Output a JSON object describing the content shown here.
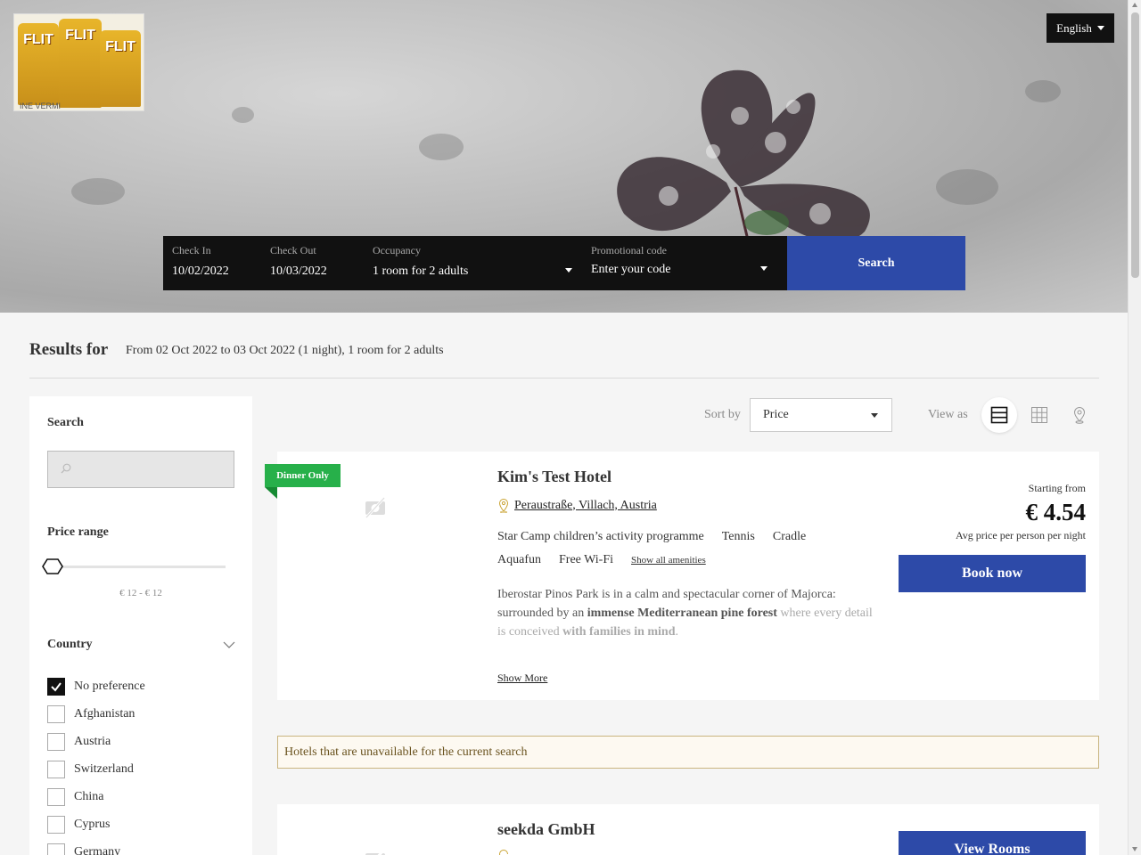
{
  "header": {
    "language": "English",
    "logo_icon": "flit-cans-logo"
  },
  "searchbar": {
    "check_in_label": "Check In",
    "check_in_value": "10/02/2022",
    "check_out_label": "Check Out",
    "check_out_value": "10/03/2022",
    "occupancy_label": "Occupancy",
    "occupancy_value": "1 room for 2 adults",
    "promo_label": "Promotional code",
    "promo_placeholder": "Enter your code",
    "search_button": "Search"
  },
  "results": {
    "title": "Results for",
    "description": "From 02 Oct 2022 to 03 Oct 2022 (1 night), 1 room for 2 adults"
  },
  "sidebar": {
    "search_title": "Search",
    "price_range_title": "Price range",
    "price_range_value": "€ 12 - € 12",
    "price_range_position": 0,
    "country_title": "Country",
    "countries": [
      {
        "label": "No preference",
        "checked": true
      },
      {
        "label": "Afghanistan",
        "checked": false
      },
      {
        "label": "Austria",
        "checked": false
      },
      {
        "label": "Switzerland",
        "checked": false
      },
      {
        "label": "China",
        "checked": false
      },
      {
        "label": "Cyprus",
        "checked": false
      },
      {
        "label": "Germany",
        "checked": false
      }
    ]
  },
  "toolbar": {
    "sort_label": "Sort by",
    "sort_value": "Price",
    "view_label": "View as",
    "views": [
      "list-view-icon",
      "grid-view-icon",
      "map-view-icon"
    ],
    "active_view": "list-view-icon"
  },
  "hotels": [
    {
      "badge": "Dinner Only",
      "name": "Kim's Test Hotel",
      "address": "Peraustraße, Villach, Austria",
      "amenities": [
        "Star Camp children’s activity programme",
        "Tennis",
        "Cradle",
        "Aquafun",
        "Free Wi-Fi"
      ],
      "show_all_amenities": "Show all amenities",
      "description_plain_1": "Iberostar Pinos Park is in a calm and spectacular corner of Majorca: surrounded by an ",
      "description_bold_1": "immense Mediterranean pine forest",
      "description_plain_2": " where every detail is conceived ",
      "description_bold_2": "with families in mind",
      "description_plain_3": ".",
      "show_more": "Show More",
      "starting_from": "Starting from",
      "price": "€ 4.54",
      "price_note": "Avg price per person per night",
      "book_button": "Book now"
    },
    {
      "name": "seekda GmbH",
      "book_button": "View Rooms"
    }
  ],
  "unavailable_notice": "Hotels that are unavailable for the current search",
  "colors": {
    "primary": "#2d4aa8",
    "badge": "#27b04a",
    "searchbar_bg": "#111111",
    "notice_border": "#c9b57f"
  }
}
